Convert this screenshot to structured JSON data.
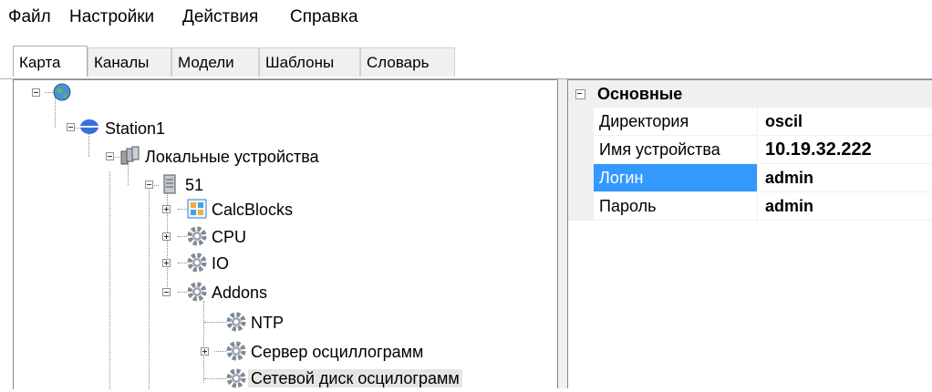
{
  "menu": {
    "items": [
      "Файл",
      "Настройки",
      "Действия",
      "Справка"
    ]
  },
  "tabs": [
    "Карта",
    "Каналы",
    "Модели",
    "Шаблоны",
    "Словарь"
  ],
  "tree": {
    "station": "Station1",
    "local_devices": "Локальные устройства",
    "device": "51",
    "calc_blocks": "CalcBlocks",
    "cpu": "CPU",
    "io": "IO",
    "addons": "Addons",
    "ntp": "NTP",
    "osc_server": "Сервер осциллограмм",
    "net_disk": "Сетевой диск осцилограмм"
  },
  "properties": {
    "group": "Основные",
    "rows": [
      {
        "name": "Директория",
        "value": "oscil"
      },
      {
        "name": "Имя устройства",
        "value": "10.19.32.222"
      },
      {
        "name": "Логин",
        "value": "admin"
      },
      {
        "name": "Пароль",
        "value": "admin"
      }
    ],
    "selected_row": "Логин"
  }
}
